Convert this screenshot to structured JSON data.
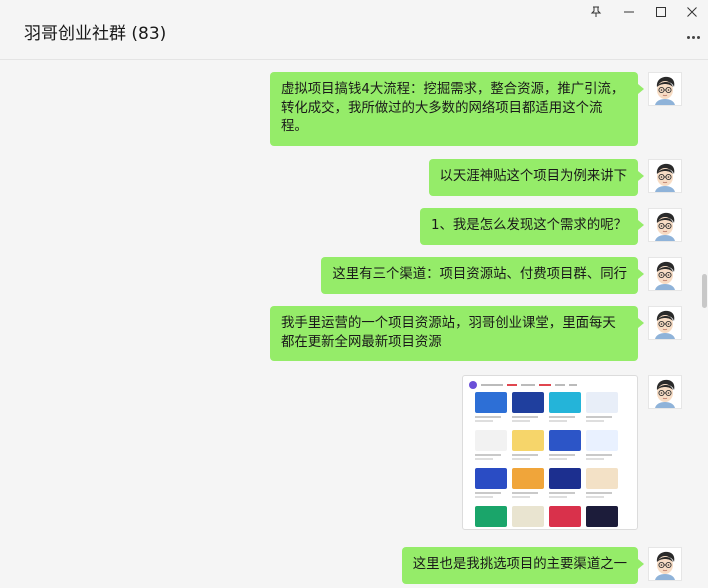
{
  "window": {
    "title": "羽哥创业社群 (83)",
    "controls": [
      "pin-icon",
      "minimize-icon",
      "maximize-icon",
      "close-icon"
    ]
  },
  "messages": [
    {
      "text": "虚拟项目搞钱4大流程：挖掘需求，整合资源，推广引流，转化成交，我所做过的大多数的网络项目都适用这个流程。"
    },
    {
      "text": "以天涯神贴这个项目为例来讲下"
    },
    {
      "text": "1、我是怎么发现这个需求的呢？"
    },
    {
      "text": "这里有三个渠道：项目资源站、付费项目群、同行"
    },
    {
      "text": "我手里运营的一个项目资源站，羽哥创业课堂，里面每天都在更新全网最新项目资源"
    },
    {
      "image": "website-screenshot-thumbnail"
    },
    {
      "text": "这里也是我挑选项目的主要渠道之一"
    }
  ],
  "colors": {
    "bubble": "#95ec69",
    "background": "#f5f5f5",
    "thumbs": [
      "#2d6fd6",
      "#1f3f9e",
      "#24b4d9",
      "#e8eef8",
      "#f2f2f2",
      "#f6d56a",
      "#2c55c7",
      "#e9f1ff",
      "#2a4cc4",
      "#f0a53a",
      "#1c2f8f",
      "#f3e1c6",
      "#1aa56a",
      "#e9e4d0",
      "#d9314b",
      "#1c1c3a",
      "#f4c542",
      "#f2bf2f",
      "#3d3bbf",
      "#5b2b8f"
    ]
  }
}
